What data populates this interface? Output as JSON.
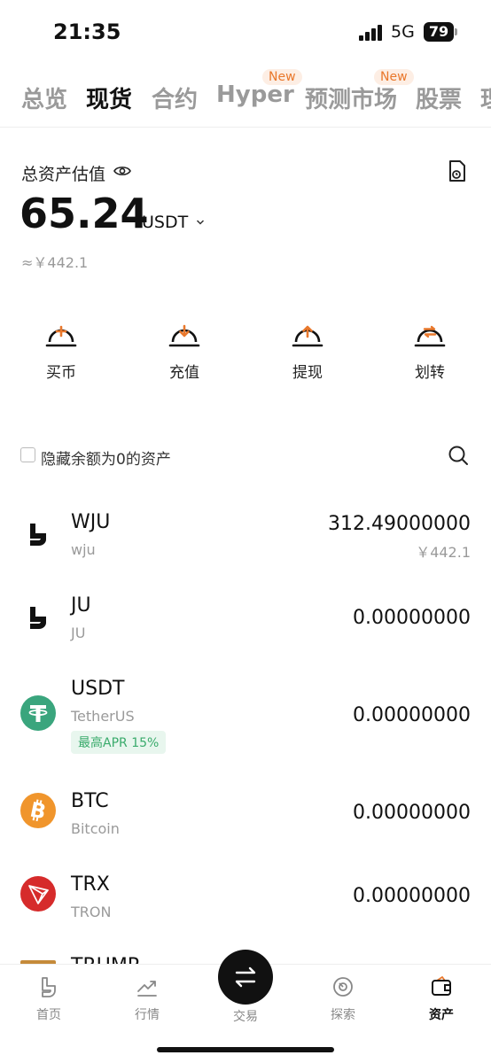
{
  "status_bar": {
    "time": "21:35",
    "network": "5G",
    "battery": "79"
  },
  "tabs": [
    {
      "label": "总览",
      "active": false
    },
    {
      "label": "现货",
      "active": true
    },
    {
      "label": "合约",
      "active": false
    },
    {
      "label": "Hyper",
      "active": false,
      "badge": "New"
    },
    {
      "label": "预测市场",
      "active": false,
      "badge": "New"
    },
    {
      "label": "股票",
      "active": false
    },
    {
      "label": "理",
      "active": false
    }
  ],
  "summary": {
    "label": "总资产估值",
    "total": "65.24",
    "unit": "USDT",
    "approx": "≈￥442.1"
  },
  "actions": [
    {
      "label": "买币",
      "icon": "plus-icon"
    },
    {
      "label": "充值",
      "icon": "arrow-down-icon"
    },
    {
      "label": "提现",
      "icon": "arrow-up-icon"
    },
    {
      "label": "划转",
      "icon": "swap-icon"
    }
  ],
  "filter": {
    "label": "隐藏余额为0的资产",
    "checked": false
  },
  "assets": [
    {
      "symbol": "WJU",
      "name": "wju",
      "amount": "312.49000000",
      "fiat": "￥442.1",
      "logo": "wju-logo"
    },
    {
      "symbol": "JU",
      "name": "JU",
      "amount": "0.00000000",
      "logo": "ju-logo"
    },
    {
      "symbol": "USDT",
      "name": "TetherUS",
      "amount": "0.00000000",
      "tag": "最高APR 15%",
      "logo": "tether-logo",
      "color": "#3aa57d"
    },
    {
      "symbol": "BTC",
      "name": "Bitcoin",
      "amount": "0.00000000",
      "logo": "bitcoin-logo",
      "color": "#f0952c"
    },
    {
      "symbol": "TRX",
      "name": "TRON",
      "amount": "0.00000000",
      "logo": "tron-logo",
      "color": "#d62b2b"
    },
    {
      "symbol": "TRUMP",
      "name": "",
      "amount": "",
      "logo": "trump-logo"
    }
  ],
  "bottom_nav": [
    {
      "label": "首页",
      "icon": "home-icon"
    },
    {
      "label": "行情",
      "icon": "chart-icon"
    },
    {
      "label": "交易",
      "icon": "trade-icon"
    },
    {
      "label": "探索",
      "icon": "explore-icon"
    },
    {
      "label": "资产",
      "icon": "wallet-icon",
      "active": true
    }
  ],
  "colors": {
    "accent": "#e9782c",
    "green": "#3aab6c",
    "text": "#111111",
    "muted": "#9a9a9a"
  }
}
